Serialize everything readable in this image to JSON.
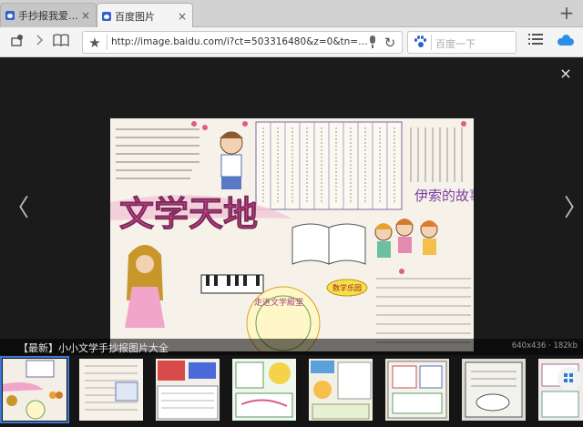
{
  "tabs": [
    {
      "title": "手抄报我爱文学...",
      "close": "×",
      "active": false
    },
    {
      "title": "百度图片",
      "close": "×",
      "active": true
    }
  ],
  "new_tab": "+",
  "toolbar": {
    "url": "http://image.baidu.com/i?ct=503316480&z=0&tn=baid...",
    "search_placeholder": "百度一下"
  },
  "viewer": {
    "close": "×",
    "prev": "〈",
    "next": "〉",
    "caption": "【最新】小小文学手抄报图片大全",
    "meta": "640x436 · 182kb",
    "picture_title": "文学天地",
    "picture_side_title": "伊索的故事",
    "picture_bubble_1": "数学乐园",
    "picture_bubble_2": "走进文学殿堂"
  },
  "thumbnails": [
    {
      "selected": true
    },
    {
      "selected": false
    },
    {
      "selected": false
    },
    {
      "selected": false
    },
    {
      "selected": false
    },
    {
      "selected": false
    },
    {
      "selected": false
    },
    {
      "selected": false
    }
  ],
  "colors": {
    "accent": "#3b78d8",
    "baidu_blue": "#2f5fd1",
    "cloud_blue": "#2a8fe6"
  }
}
